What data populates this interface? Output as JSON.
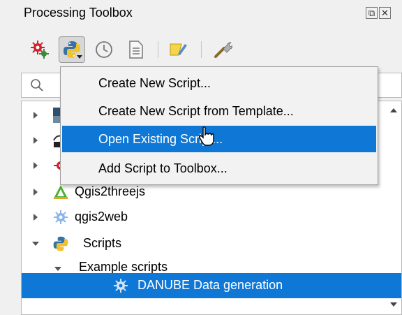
{
  "window": {
    "title": "Processing Toolbox",
    "float_icon": "float-window-icon",
    "close_icon": "close-icon"
  },
  "toolbar": {
    "tools": [
      {
        "name": "models-icon",
        "active": false
      },
      {
        "name": "python-scripts-icon",
        "active": true
      },
      {
        "name": "history-icon",
        "active": false
      },
      {
        "name": "results-viewer-icon",
        "active": false
      },
      {
        "name": "edit-features-in-place-icon",
        "active": false
      },
      {
        "name": "options-icon",
        "active": false
      }
    ]
  },
  "search": {
    "placeholder": ""
  },
  "menu": {
    "items": [
      {
        "label": "Create New Script...",
        "highlighted": false
      },
      {
        "label": "Create New Script from Template...",
        "highlighted": false
      },
      {
        "label": "Open Existing Script...",
        "highlighted": true
      },
      {
        "label": "Add Script to Toolbox...",
        "highlighted": false
      }
    ]
  },
  "tree": {
    "items": [
      {
        "label": "",
        "icon": "provider-image-icon",
        "expanded": false
      },
      {
        "label": "",
        "icon": "gdal-icon",
        "expanded": false
      },
      {
        "label": "",
        "icon": "grass-icon",
        "expanded": false
      },
      {
        "label": "Qgis2threejs",
        "icon": "qgis2threejs-icon",
        "expanded": false
      },
      {
        "label": "qgis2web",
        "icon": "qgis2web-icon",
        "expanded": false
      },
      {
        "label": "Scripts",
        "icon": "python-icon",
        "expanded": true
      },
      {
        "label": "Example scripts",
        "icon": "",
        "expanded": true
      },
      {
        "label": "DANUBE Data generation",
        "icon": "script-gear-icon",
        "selected": true
      }
    ]
  },
  "colors": {
    "highlight": "#0f78d7",
    "background": "#f0f0f0"
  }
}
